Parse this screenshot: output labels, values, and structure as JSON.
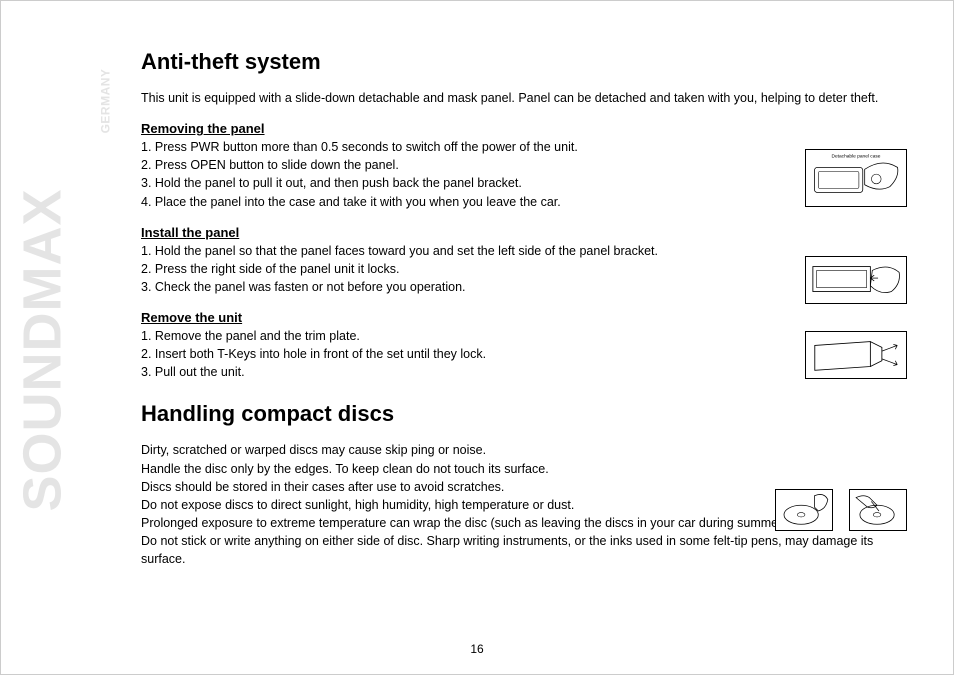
{
  "brand": {
    "name": "SOUNDMAX",
    "country": "GERMANY"
  },
  "page_number": "16",
  "section1": {
    "title": "Anti-theft system",
    "intro": "This unit is equipped with a slide-down detachable and mask panel. Panel can be detached and taken with you, helping to deter theft.",
    "removing": {
      "heading": "Removing the panel",
      "steps": "1. Press PWR button more than 0.5 seconds to switch off the power of the unit.\n2. Press OPEN button to slide down the panel.\n3. Hold the panel to pull it out, and then push back the panel bracket.\n4. Place the panel into the case and take it with you when you leave the car."
    },
    "install": {
      "heading": "Install the panel",
      "steps": "1. Hold the panel so that the panel faces toward you and set the left side of the panel bracket.\n2. Press the right side of the panel unit it locks.\n3. Check the panel was fasten or not before you operation."
    },
    "remove_unit": {
      "heading": "Remove the unit",
      "steps": "1. Remove the panel and the trim plate.\n2. Insert both T-Keys into hole in front of the set until they lock.\n3. Pull out the unit."
    },
    "illus1_caption": "Detachable panel case"
  },
  "section2": {
    "title": "Handling compact discs",
    "body": "Dirty, scratched or warped discs may cause skip ping or noise.\nHandle the disc only by the edges. To keep clean do not touch its surface.\nDiscs should be stored in their cases after use to avoid scratches.\nDo not expose discs to direct sunlight, high humidity, high temperature or dust.\nProlonged exposure to extreme temperature can wrap the disc (such as leaving the discs in your car during summertime).\nDo not stick or write anything on either side of disc. Sharp writing instruments, or the inks used in some felt-tip pens, may damage its surface."
  }
}
